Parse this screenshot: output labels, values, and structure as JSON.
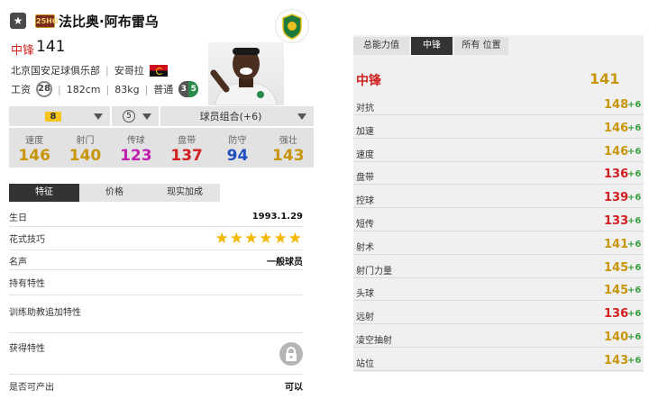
{
  "header": {
    "season_badge": "25HG",
    "player_name": "法比奥·阿布雷乌",
    "position": "中锋",
    "position_ovr": "141",
    "club": "北京国安足球俱乐部",
    "nation": "安哥拉",
    "salary_label": "工资",
    "salary": "28",
    "height": "182cm",
    "weight": "83kg",
    "body_type": "普通",
    "weak_foot_left": "3",
    "weak_foot_right": "5"
  },
  "selectors": {
    "upgrade": "8",
    "level": "5",
    "team_color": "球员组合(+6)"
  },
  "stats": [
    {
      "label": "速度",
      "value": "146",
      "color": "#c8960a"
    },
    {
      "label": "射门",
      "value": "140",
      "color": "#c8960a"
    },
    {
      "label": "传球",
      "value": "123",
      "color": "#c020b0"
    },
    {
      "label": "盘带",
      "value": "137",
      "color": "#d02020"
    },
    {
      "label": "防守",
      "value": "94",
      "color": "#2050c0"
    },
    {
      "label": "强壮",
      "value": "143",
      "color": "#c8960a"
    }
  ],
  "left_tabs": [
    "特征",
    "价格",
    "现实加成"
  ],
  "info": {
    "birthday_label": "生日",
    "birthday": "1993.1.29",
    "skill_label": "花式技巧",
    "skill_stars": "★★★★★★",
    "fame_label": "名声",
    "fame": "一般球员",
    "traits_label": "持有特性",
    "coach_traits_label": "训练助教追加特性",
    "acquired_traits_label": "获得特性",
    "producible_label": "是否可产出",
    "producible": "可以"
  },
  "right_tabs": [
    "总能力值",
    "中锋",
    "所有 位置"
  ],
  "right_header": {
    "label": "中锋",
    "value": "141"
  },
  "attributes": [
    {
      "label": "对抗",
      "value": "148",
      "bonus": "+6",
      "color": "#c8960a"
    },
    {
      "label": "加速",
      "value": "146",
      "bonus": "+6",
      "color": "#c8960a"
    },
    {
      "label": "速度",
      "value": "146",
      "bonus": "+6",
      "color": "#c8960a"
    },
    {
      "label": "盘带",
      "value": "136",
      "bonus": "+6",
      "color": "#d02020"
    },
    {
      "label": "控球",
      "value": "139",
      "bonus": "+6",
      "color": "#d02020"
    },
    {
      "label": "短传",
      "value": "133",
      "bonus": "+6",
      "color": "#d02020"
    },
    {
      "label": "射术",
      "value": "141",
      "bonus": "+6",
      "color": "#c8960a"
    },
    {
      "label": "射门力量",
      "value": "145",
      "bonus": "+6",
      "color": "#c8960a"
    },
    {
      "label": "头球",
      "value": "145",
      "bonus": "+6",
      "color": "#c8960a"
    },
    {
      "label": "远射",
      "value": "136",
      "bonus": "+6",
      "color": "#d02020"
    },
    {
      "label": "凌空抽射",
      "value": "140",
      "bonus": "+6",
      "color": "#c8960a"
    },
    {
      "label": "站位",
      "value": "143",
      "bonus": "+6",
      "color": "#c8960a"
    }
  ]
}
